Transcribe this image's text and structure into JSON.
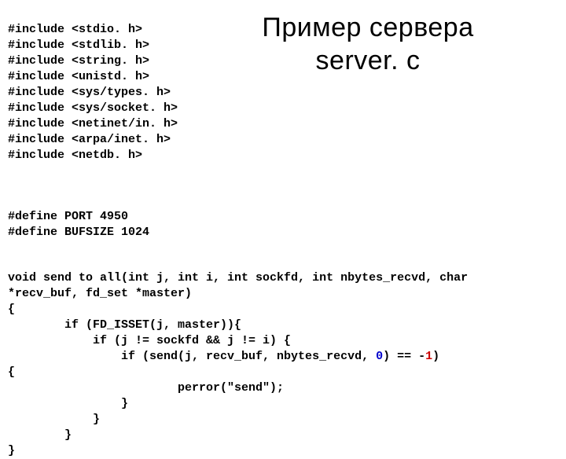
{
  "title": {
    "line1": "Пример сервера",
    "line2": "server. c"
  },
  "includes": [
    "#include <stdio. h>",
    "#include <stdlib. h>",
    "#include <string. h>",
    "#include <unistd. h>",
    "#include <sys/types. h>",
    "#include <sys/socket. h>",
    "#include <netinet/in. h>",
    "#include <arpa/inet. h>",
    "#include <netdb. h>"
  ],
  "defines": [
    "#define PORT 4950",
    "#define BUFSIZE 1024"
  ],
  "code": {
    "sig1": "void send to all(int j, int i, int sockfd, int nbytes_recvd, char",
    "sig2": "*recv_buf, fd_set *master)",
    "l1": "{",
    "l2": "        if (FD_ISSET(j, master)){",
    "l3": "            if (j != sockfd && j != i) {",
    "l4a": "                if (send(j, recv_buf, nbytes_recvd, ",
    "l4_zero": "0",
    "l4b": ") == ",
    "l4_neg": "-",
    "l4_one": "1",
    "l4c": ")",
    "l5": "{",
    "l6": "                        perror(\"send\");",
    "l7": "                }",
    "l8": "            }",
    "l9": "        }",
    "l10": "}"
  }
}
